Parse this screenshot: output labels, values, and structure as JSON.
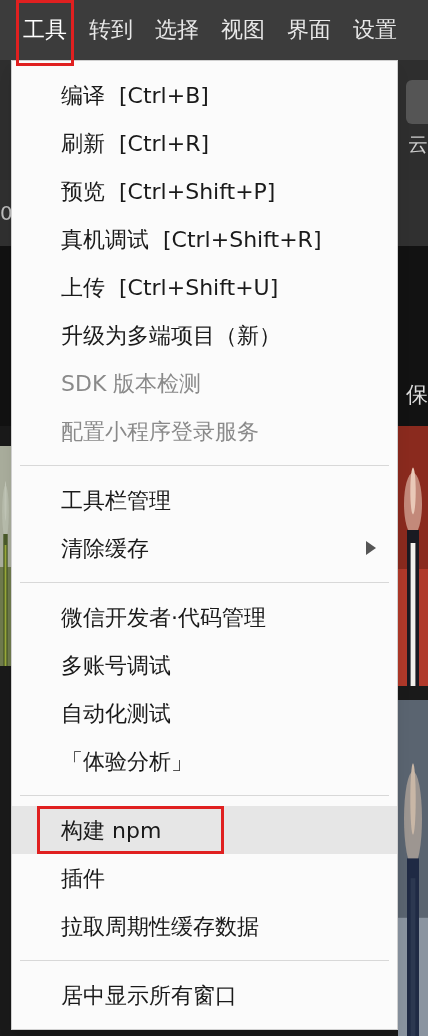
{
  "menubar": [
    {
      "label": "工具",
      "selected": true,
      "annotated": true
    },
    {
      "label": "转到",
      "selected": false,
      "annotated": false
    },
    {
      "label": "选择",
      "selected": false,
      "annotated": false
    },
    {
      "label": "视图",
      "selected": false,
      "annotated": false
    },
    {
      "label": "界面",
      "selected": false,
      "annotated": false
    },
    {
      "label": "设置",
      "selected": false,
      "annotated": false
    }
  ],
  "background": {
    "toolbar_label": "云",
    "tab_label": "0",
    "save_label": "保"
  },
  "menu": {
    "groups": [
      {
        "items": [
          {
            "label": "编译",
            "shortcut": "[Ctrl+B]",
            "disabled": false,
            "submenu": false,
            "selected": false,
            "annotated": false
          },
          {
            "label": "刷新",
            "shortcut": "[Ctrl+R]",
            "disabled": false,
            "submenu": false,
            "selected": false,
            "annotated": false
          },
          {
            "label": "预览",
            "shortcut": "[Ctrl+Shift+P]",
            "disabled": false,
            "submenu": false,
            "selected": false,
            "annotated": false
          },
          {
            "label": "真机调试",
            "shortcut": "[Ctrl+Shift+R]",
            "disabled": false,
            "submenu": false,
            "selected": false,
            "annotated": false
          },
          {
            "label": "上传",
            "shortcut": "[Ctrl+Shift+U]",
            "disabled": false,
            "submenu": false,
            "selected": false,
            "annotated": false
          },
          {
            "label": "升级为多端项目（新）",
            "disabled": false,
            "submenu": false,
            "selected": false,
            "annotated": false
          },
          {
            "label": "SDK 版本检测",
            "disabled": true,
            "submenu": false,
            "selected": false,
            "annotated": false
          },
          {
            "label": "配置小程序登录服务",
            "disabled": true,
            "submenu": false,
            "selected": false,
            "annotated": false
          }
        ]
      },
      {
        "items": [
          {
            "label": "工具栏管理",
            "disabled": false,
            "submenu": false,
            "selected": false,
            "annotated": false
          },
          {
            "label": "清除缓存",
            "disabled": false,
            "submenu": true,
            "selected": false,
            "annotated": false
          }
        ]
      },
      {
        "items": [
          {
            "label": "微信开发者·代码管理",
            "disabled": false,
            "submenu": false,
            "selected": false,
            "annotated": false
          },
          {
            "label": "多账号调试",
            "disabled": false,
            "submenu": false,
            "selected": false,
            "annotated": false
          },
          {
            "label": "自动化测试",
            "disabled": false,
            "submenu": false,
            "selected": false,
            "annotated": false
          },
          {
            "label": "「体验分析」",
            "disabled": false,
            "submenu": false,
            "selected": false,
            "annotated": false
          }
        ]
      },
      {
        "items": [
          {
            "label": "构建 npm",
            "disabled": false,
            "submenu": false,
            "selected": true,
            "annotated": true
          },
          {
            "label": "插件",
            "disabled": false,
            "submenu": false,
            "selected": false,
            "annotated": false
          },
          {
            "label": "拉取周期性缓存数据",
            "disabled": false,
            "submenu": false,
            "selected": false,
            "annotated": false
          }
        ]
      },
      {
        "items": [
          {
            "label": "居中显示所有窗口",
            "disabled": false,
            "submenu": false,
            "selected": false,
            "annotated": false
          }
        ]
      }
    ]
  }
}
